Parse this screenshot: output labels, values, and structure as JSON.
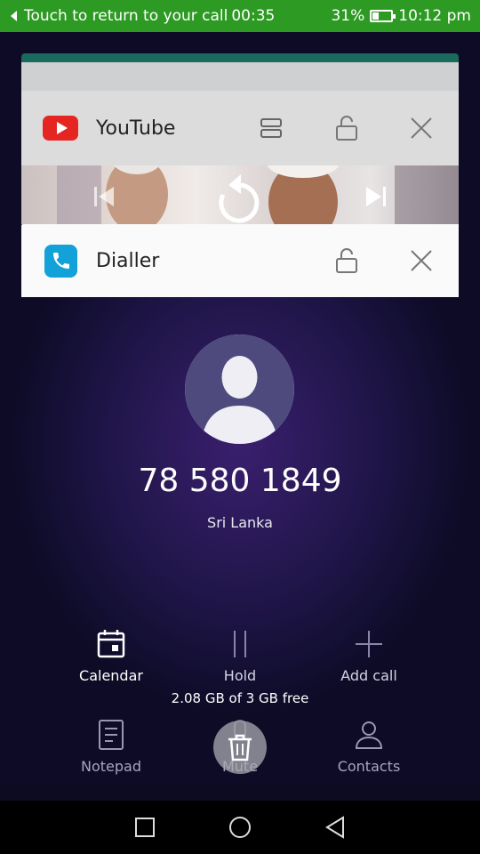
{
  "status_bar": {
    "call_text": "Touch to return to your call",
    "call_timer": "00:35",
    "battery_percent": "31%",
    "battery_level": 0.31,
    "time": "10:12 pm",
    "color": "#2d9a23"
  },
  "recent_apps": {
    "youtube": {
      "title": "YouTube",
      "icons": [
        "split-screen-icon",
        "unlock-icon",
        "close-icon"
      ],
      "brand_color": "#e52521"
    },
    "dialler": {
      "title": "Dialler",
      "icons": [
        "unlock-icon",
        "close-icon"
      ],
      "brand_color": "#12a1d8",
      "call": {
        "phone_number": "78 580 1849",
        "location": "Sri Lanka"
      },
      "actions": [
        {
          "label": "Calendar",
          "icon": "calendar-icon"
        },
        {
          "label": "Hold",
          "icon": "pause-icon"
        },
        {
          "label": "Add call",
          "icon": "plus-icon"
        },
        {
          "label": "Notepad",
          "icon": "notepad-icon"
        },
        {
          "label": "Mute",
          "icon": "microphone-icon"
        },
        {
          "label": "Contacts",
          "icon": "person-icon"
        }
      ]
    }
  },
  "memory": {
    "text": "2.08 GB of 3 GB free"
  },
  "nav_bar": {
    "icons": [
      "recents-square-icon",
      "home-circle-icon",
      "back-triangle-icon"
    ]
  }
}
